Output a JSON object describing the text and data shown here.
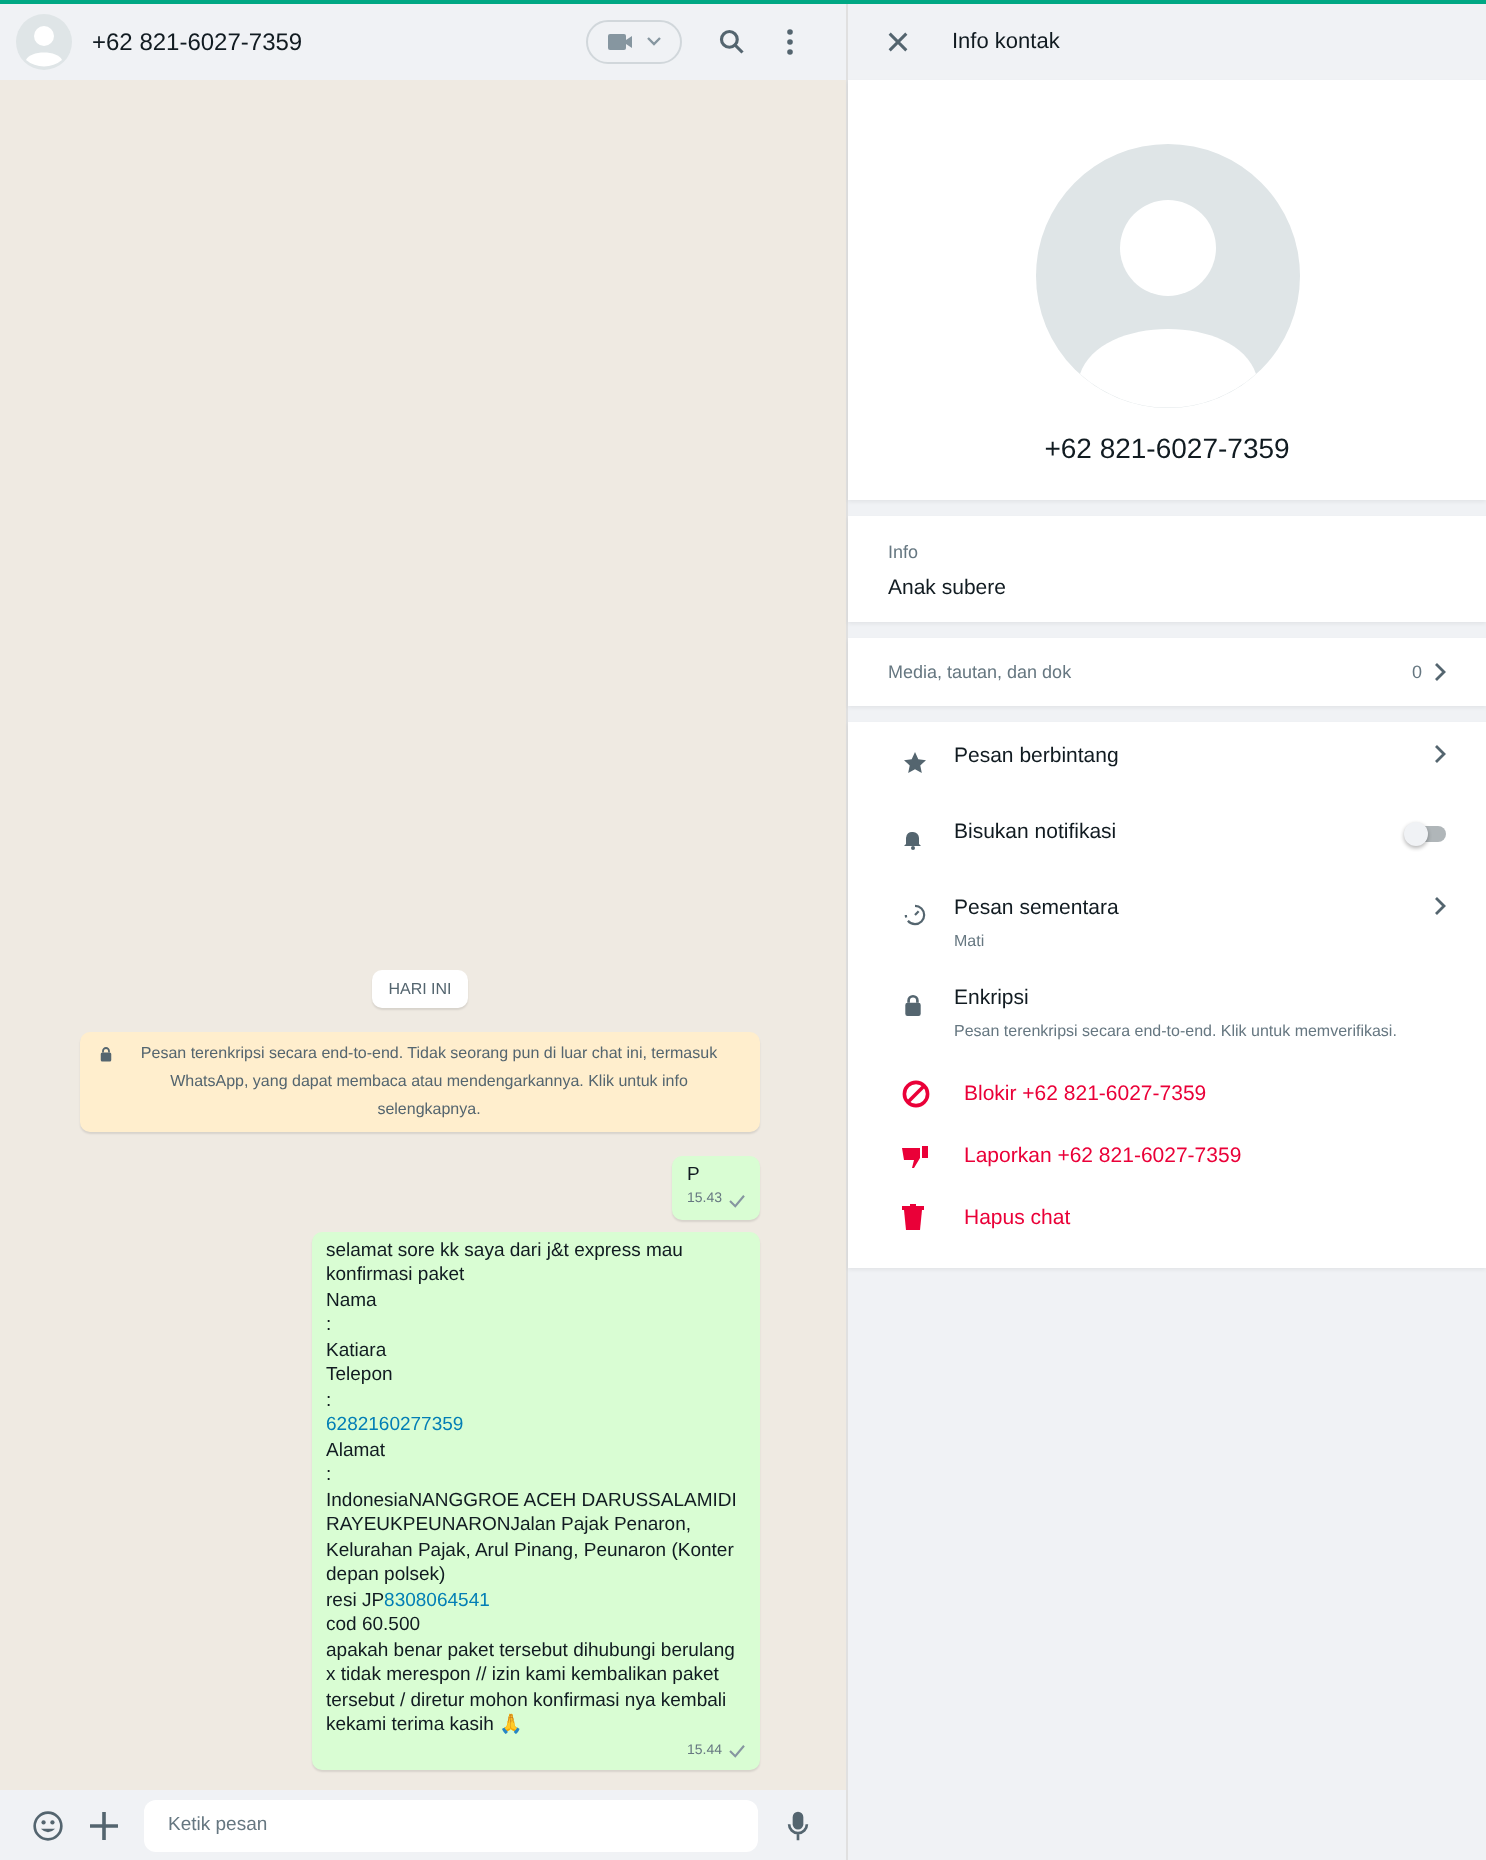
{
  "chat_header": {
    "contact": "+62 821-6027-7359"
  },
  "chat": {
    "date_chip": "HARI INI",
    "encryption_notice": "Pesan terenkripsi secara end-to-end. Tidak seorang pun di luar chat ini, termasuk WhatsApp, yang dapat membaca atau mendengarkannya. Klik untuk info selengkapnya.",
    "messages": [
      {
        "paragraphs": [
          [
            {
              "text": "P"
            }
          ]
        ],
        "time": "15.43"
      },
      {
        "paragraphs": [
          [
            {
              "text": "selamat sore kk saya dari j&t express mau konfirmasi paket"
            }
          ],
          [
            {
              "text": "Nama"
            }
          ],
          [
            {
              "text": ":"
            }
          ],
          [
            {
              "text": "Katiara"
            }
          ],
          [
            {
              "text": "Telepon"
            }
          ],
          [
            {
              "text": ":"
            }
          ],
          [
            {
              "text": "6282160277359",
              "link": true
            }
          ],
          [
            {
              "text": "Alamat"
            }
          ],
          [
            {
              "text": ":"
            }
          ],
          [
            {
              "text": "IndonesiaNANGGROE ACEH DARUSSALAMIDI RAYEUKPEUNARONJalan Pajak Penaron, Kelurahan Pajak, Arul Pinang, Peunaron (Konter depan polsek)"
            }
          ],
          [
            {
              "text": "resi JP"
            },
            {
              "text": "8308064541",
              "link": true
            }
          ],
          [
            {
              "text": "cod  60.500"
            }
          ],
          [
            {
              "text": "apakah benar paket tersebut  dihubungi berulang x tidak merespon  // izin kami kembalikan paket tersebut / diretur  mohon konfirmasi nya kembali kekami terima kasih  🙏"
            }
          ]
        ],
        "time": "15.44"
      }
    ]
  },
  "composer": {
    "placeholder": "Ketik pesan"
  },
  "info_panel": {
    "title": "Info kontak",
    "contact": "+62 821-6027-7359",
    "about": {
      "label": "Info",
      "value": "Anak subere"
    },
    "media": {
      "label": "Media, tautan, dan dok",
      "count": "0"
    },
    "settings": [
      {
        "kind": "link",
        "label": "Pesan berbintang"
      },
      {
        "kind": "toggle",
        "label": "Bisukan notifikasi",
        "on": false
      },
      {
        "kind": "link",
        "label": "Pesan sementara",
        "sub": "Mati"
      },
      {
        "kind": "plain",
        "label": "Enkripsi",
        "sub": "Pesan terenkripsi secara end-to-end. Klik untuk memverifikasi."
      }
    ],
    "actions": [
      {
        "label": "Blokir +62 821-6027-7359"
      },
      {
        "label": "Laporkan +62 821-6027-7359"
      },
      {
        "label": "Hapus chat"
      }
    ]
  }
}
